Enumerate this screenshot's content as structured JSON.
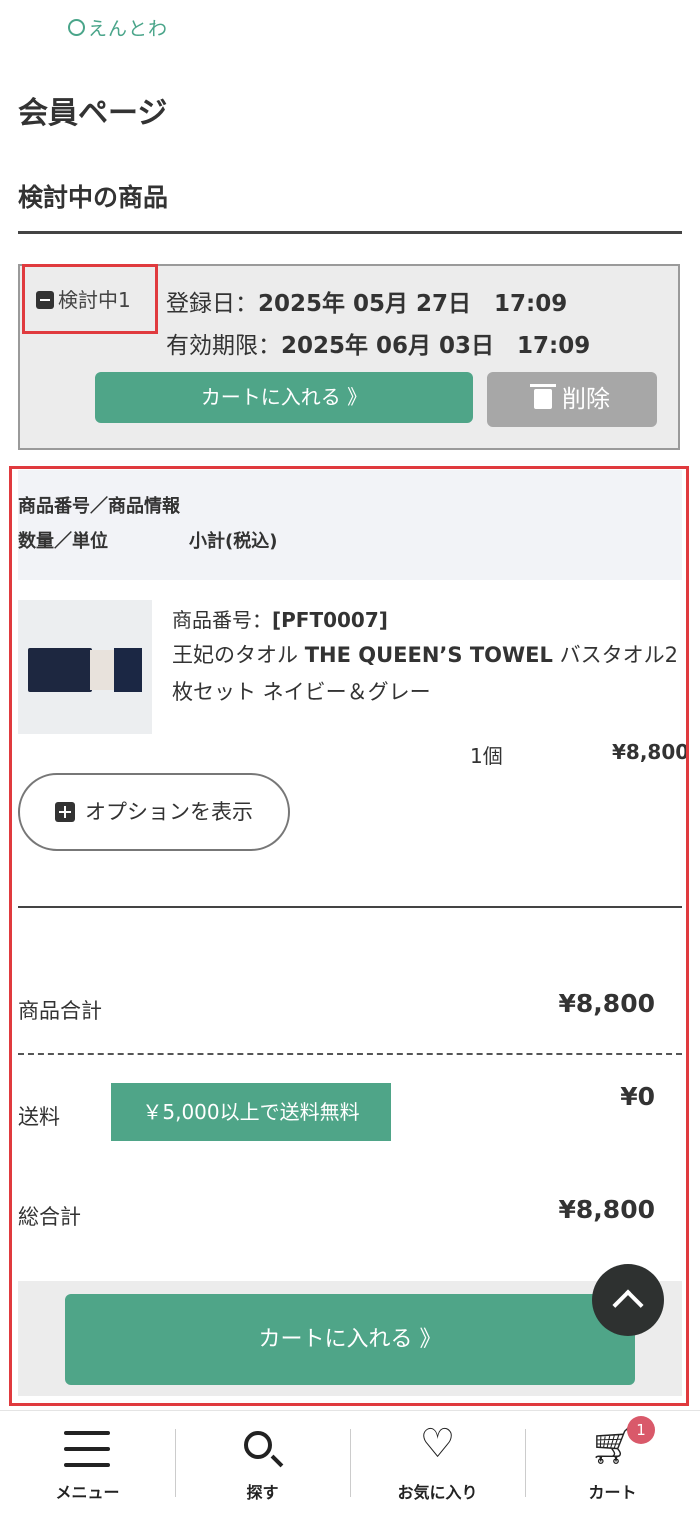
{
  "header": {
    "logo_text": "えんとわ"
  },
  "page_title": "会員ページ",
  "section_title": "検討中の商品",
  "considering": {
    "status_label": "検討中1",
    "registered_label": "登録日：",
    "registered_value": "2025年 05月 27日　17:09",
    "expiry_label": "有効期限：",
    "expiry_value": "2025年 06月 03日　17:09",
    "add_to_cart": "カートに入れる 》",
    "delete": "削除"
  },
  "table": {
    "header_line1": "商品番号／商品情報",
    "header_qty": "数量／単位",
    "header_subtotal": "小計(税込)"
  },
  "product": {
    "code_label": "商品番号：",
    "code_value": "[PFT0007]",
    "name_prefix": "王妃のタオル ",
    "name_bold": "THE QUEEN’S TOWEL",
    "name_suffix": " バスタオル2枚セット ネイビー＆グレー",
    "quantity": "1個",
    "price": "¥8,800",
    "show_options": "オプションを表示"
  },
  "summary": {
    "items_total_label": "商品合計",
    "items_total_value": "¥8,800",
    "shipping_label": "送料",
    "shipping_badge": "￥5,000以上で送料無料",
    "shipping_value": "¥0",
    "grand_total_label": "総合計",
    "grand_total_value": "¥8,800",
    "add_to_cart": "カートに入れる 》"
  },
  "nav": {
    "menu": "メニュー",
    "search": "探す",
    "favorites": "お気に入り",
    "cart": "カート",
    "cart_count": "1"
  },
  "colors": {
    "accent": "#4fa588",
    "highlight": "#e03a3e",
    "badge": "#d9596a"
  }
}
